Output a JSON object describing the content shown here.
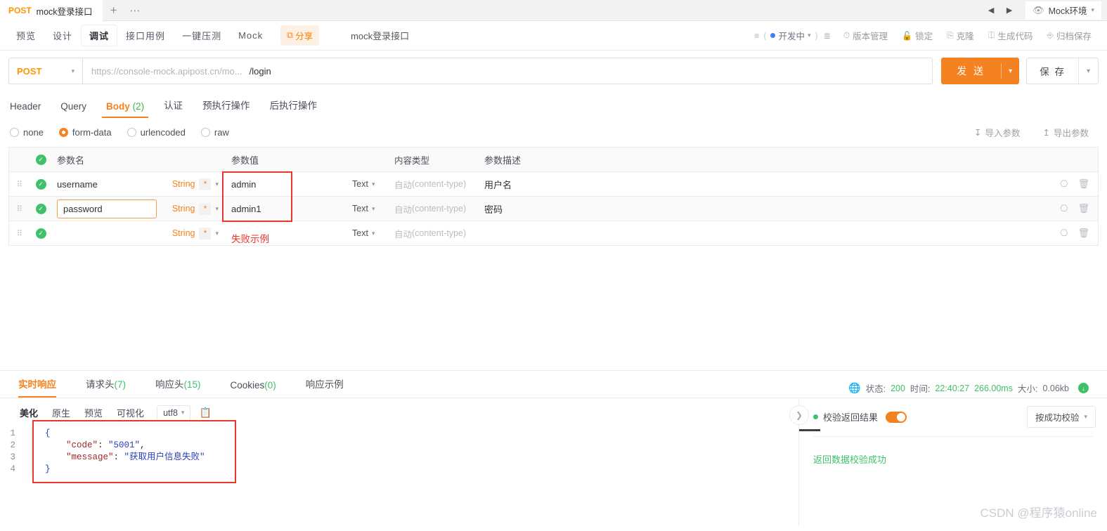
{
  "tabstrip": {
    "request_tab": {
      "method": "POST",
      "name": "mock登录接口"
    },
    "new_tab": "+",
    "more": "⋯",
    "prev_arrow": "◀",
    "next_arrow": "▶",
    "environment": {
      "label": "Mock环境",
      "icon": "eye-icon",
      "chevron": "∨"
    }
  },
  "toolbar": {
    "view_tabs": [
      {
        "label": "预览",
        "active": false
      },
      {
        "label": "设计",
        "active": false
      },
      {
        "label": "调试",
        "active": true
      },
      {
        "label": "接口用例",
        "active": false
      },
      {
        "label": "一键压测",
        "active": false
      },
      {
        "label": "Mock",
        "active": false
      }
    ],
    "share_label": "分享",
    "api_name": "mock登录接口",
    "status_label": "开发中",
    "actions": [
      {
        "label": "版本管理",
        "icon": "clock-icon"
      },
      {
        "label": "锁定",
        "icon": "lock-icon"
      },
      {
        "label": "克隆",
        "icon": "copy-icon"
      },
      {
        "label": "生成代码",
        "icon": "code-icon"
      },
      {
        "label": "归档保存",
        "icon": "archive-icon"
      }
    ]
  },
  "urlbar": {
    "method": "POST",
    "url_prefix": "https://console-mock.apipost.cn/mo...",
    "url_path": "/login",
    "send_label": "发 送",
    "save_label": "保 存"
  },
  "request_tabs": [
    {
      "label": "Header",
      "count": "",
      "active": false
    },
    {
      "label": "Query",
      "count": "",
      "active": false
    },
    {
      "label": "Body",
      "count": "(2)",
      "active": true
    },
    {
      "label": "认证",
      "count": "",
      "active": false
    },
    {
      "label": "预执行操作",
      "count": "",
      "active": false
    },
    {
      "label": "后执行操作",
      "count": "",
      "active": false
    }
  ],
  "body_type": {
    "options": [
      {
        "label": "none",
        "selected": false
      },
      {
        "label": "form-data",
        "selected": true
      },
      {
        "label": "urlencoded",
        "selected": false
      },
      {
        "label": "raw",
        "selected": false
      }
    ],
    "import_label": "导入参数",
    "export_label": "导出参数"
  },
  "param_table": {
    "headers": {
      "name": "参数名",
      "value": "参数值",
      "content_type": "内容类型",
      "description": "参数描述"
    },
    "rows": [
      {
        "name": "username",
        "type": "String",
        "required": "*",
        "value": "admin",
        "value_kind": "Text",
        "content_type_auto": "自动",
        "content_type_hint": "(content-type)",
        "description": "用户名",
        "name_editing": false
      },
      {
        "name": "password",
        "type": "String",
        "required": "*",
        "value": "admin1",
        "value_kind": "Text",
        "content_type_auto": "自动",
        "content_type_hint": "(content-type)",
        "description": "密码",
        "name_editing": true
      },
      {
        "name": "",
        "type": "String",
        "required": "*",
        "value": "",
        "value_kind": "Text",
        "content_type_auto": "自动",
        "content_type_hint": "(content-type)",
        "description": "",
        "name_editing": false
      }
    ],
    "annotation": "失败示例",
    "row_actions": {
      "box_icon": "cube-icon",
      "delete_icon": "trash-icon"
    }
  },
  "response": {
    "tabs": [
      {
        "label": "实时响应",
        "count": "",
        "active": true
      },
      {
        "label": "请求头",
        "count": "(7)",
        "active": false
      },
      {
        "label": "响应头",
        "count": "(15)",
        "active": false
      },
      {
        "label": "Cookies",
        "count": "(0)",
        "active": false
      },
      {
        "label": "响应示例",
        "count": "",
        "active": false
      }
    ],
    "status": {
      "status_label": "状态:",
      "status_value": "200",
      "time_label": "时间:",
      "time_value": "22:40:27",
      "duration": "266.00ms",
      "size_label": "大小:",
      "size_value": "0.06kb",
      "download_icon": "download-icon"
    },
    "format_tabs": [
      {
        "label": "美化",
        "active": true
      },
      {
        "label": "原生",
        "active": false
      },
      {
        "label": "预览",
        "active": false
      },
      {
        "label": "可视化",
        "active": false
      }
    ],
    "encoding": "utf8",
    "copy_icon": "copy-icon",
    "line_numbers": [
      "1",
      "2",
      "3",
      "4"
    ],
    "body_lines": [
      "{",
      "    \"code\": \"5001\",",
      "    \"message\": \"获取用户信息失败\"",
      "}"
    ],
    "body_json": {
      "code": "5001",
      "message": "获取用户信息失败"
    },
    "validation": {
      "title": "校验返回结果",
      "toggle_on": true,
      "mode": "按成功校验",
      "result": "返回数据校验成功"
    }
  },
  "watermark": "CSDN @程序猿online",
  "colors": {
    "accent": "#f58220",
    "success": "#3ec16a",
    "danger": "#e8362a",
    "blue": "#3b82f6"
  }
}
